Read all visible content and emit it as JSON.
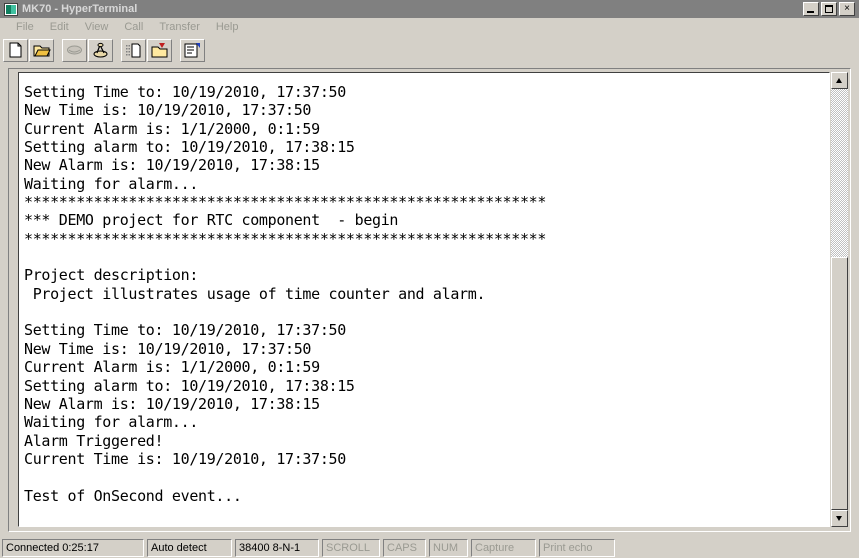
{
  "window": {
    "title": "MK70 - HyperTerminal",
    "icon": "terminal-icon",
    "controls": {
      "minimize": "minimize-button",
      "maximize": "maximize-button",
      "close": "×"
    }
  },
  "menubar": {
    "items": [
      {
        "label": "File"
      },
      {
        "label": "Edit"
      },
      {
        "label": "View"
      },
      {
        "label": "Call"
      },
      {
        "label": "Transfer"
      },
      {
        "label": "Help"
      }
    ]
  },
  "toolbar": {
    "buttons": [
      {
        "name": "new-connection-icon",
        "title": "New"
      },
      {
        "name": "open-folder-icon",
        "title": "Open"
      },
      {
        "name": "call-icon",
        "title": "Call"
      },
      {
        "name": "disconnect-icon",
        "title": "Disconnect"
      },
      {
        "name": "send-file-icon",
        "title": "Send"
      },
      {
        "name": "receive-file-icon",
        "title": "Receive"
      },
      {
        "name": "properties-icon",
        "title": "Properties"
      }
    ]
  },
  "terminal": {
    "lines": [
      "Setting Time to: 10/19/2010, 17:37:50",
      "New Time is: 10/19/2010, 17:37:50",
      "Current Alarm is: 1/1/2000, 0:1:59",
      "Setting alarm to: 10/19/2010, 17:38:15",
      "New Alarm is: 10/19/2010, 17:38:15",
      "Waiting for alarm...",
      "************************************************************",
      "*** DEMO project for RTC component  - begin",
      "************************************************************",
      "",
      "Project description:",
      " Project illustrates usage of time counter and alarm.",
      "",
      "Setting Time to: 10/19/2010, 17:37:50",
      "New Time is: 10/19/2010, 17:37:50",
      "Current Alarm is: 1/1/2000, 0:1:59",
      "Setting alarm to: 10/19/2010, 17:38:15",
      "New Alarm is: 10/19/2010, 17:38:15",
      "Waiting for alarm...",
      "Alarm Triggered!",
      "Current Time is: 10/19/2010, 17:37:50",
      "",
      "Test of OnSecond event..."
    ],
    "text": "Setting Time to: 10/19/2010, 17:37:50\nNew Time is: 10/19/2010, 17:37:50\nCurrent Alarm is: 1/1/2000, 0:1:59\nSetting alarm to: 10/19/2010, 17:38:15\nNew Alarm is: 10/19/2010, 17:38:15\nWaiting for alarm...\n************************************************************\n*** DEMO project for RTC component  - begin\n************************************************************\n\nProject description:\n Project illustrates usage of time counter and alarm.\n\nSetting Time to: 10/19/2010, 17:37:50\nNew Time is: 10/19/2010, 17:37:50\nCurrent Alarm is: 1/1/2000, 0:1:59\nSetting alarm to: 10/19/2010, 17:38:15\nNew Alarm is: 10/19/2010, 17:38:15\nWaiting for alarm...\nAlarm Triggered!\nCurrent Time is: 10/19/2010, 17:37:50\n\nTest of OnSecond event..."
  },
  "scrollbar": {
    "up_arrow": "▲",
    "down_arrow": "▼"
  },
  "statusbar": {
    "connected": "Connected 0:25:17",
    "detect": "Auto detect",
    "settings": "38400 8-N-1",
    "scroll": "SCROLL",
    "caps": "CAPS",
    "num": "NUM",
    "capture": "Capture",
    "print_echo": "Print echo"
  },
  "colors": {
    "window_face": "#d4d0c8",
    "titlebar_inactive": "#808080",
    "terminal_bg": "#ffffff",
    "terminal_fg": "#000000",
    "disabled_text": "#9a9a92"
  }
}
